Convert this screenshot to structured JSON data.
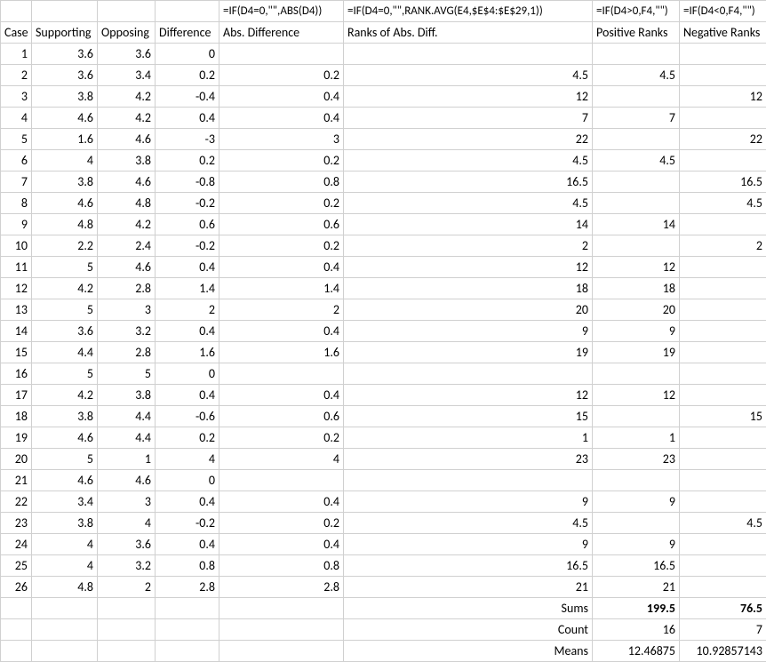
{
  "formulas": {
    "abs": "=IF(D4=0,\"\",ABS(D4))",
    "rank": "=IF(D4=0,\"\",RANK.AVG(E4,$E$4:$E$29,1))",
    "pos": "=IF(D4>0,F4,\"\")",
    "neg": "=IF(D4<0,F4,\"\")"
  },
  "headers": {
    "case": "Case",
    "sup": "Supporting",
    "opp": "Opposing",
    "diff": "Difference",
    "abs": "Abs. Difference",
    "rank": "Ranks of Abs. Diff.",
    "pos": "Positive Ranks",
    "neg": "Negative Ranks"
  },
  "rows": [
    {
      "case": "1",
      "sup": "3.6",
      "opp": "3.6",
      "diff": "0",
      "abs": "",
      "rank": "",
      "pos": "",
      "neg": ""
    },
    {
      "case": "2",
      "sup": "3.6",
      "opp": "3.4",
      "diff": "0.2",
      "abs": "0.2",
      "rank": "4.5",
      "pos": "4.5",
      "neg": ""
    },
    {
      "case": "3",
      "sup": "3.8",
      "opp": "4.2",
      "diff": "-0.4",
      "abs": "0.4",
      "rank": "12",
      "pos": "",
      "neg": "12"
    },
    {
      "case": "4",
      "sup": "4.6",
      "opp": "4.2",
      "diff": "0.4",
      "abs": "0.4",
      "rank": "7",
      "pos": "7",
      "neg": ""
    },
    {
      "case": "5",
      "sup": "1.6",
      "opp": "4.6",
      "diff": "-3",
      "abs": "3",
      "rank": "22",
      "pos": "",
      "neg": "22"
    },
    {
      "case": "6",
      "sup": "4",
      "opp": "3.8",
      "diff": "0.2",
      "abs": "0.2",
      "rank": "4.5",
      "pos": "4.5",
      "neg": ""
    },
    {
      "case": "7",
      "sup": "3.8",
      "opp": "4.6",
      "diff": "-0.8",
      "abs": "0.8",
      "rank": "16.5",
      "pos": "",
      "neg": "16.5"
    },
    {
      "case": "8",
      "sup": "4.6",
      "opp": "4.8",
      "diff": "-0.2",
      "abs": "0.2",
      "rank": "4.5",
      "pos": "",
      "neg": "4.5"
    },
    {
      "case": "9",
      "sup": "4.8",
      "opp": "4.2",
      "diff": "0.6",
      "abs": "0.6",
      "rank": "14",
      "pos": "14",
      "neg": ""
    },
    {
      "case": "10",
      "sup": "2.2",
      "opp": "2.4",
      "diff": "-0.2",
      "abs": "0.2",
      "rank": "2",
      "pos": "",
      "neg": "2"
    },
    {
      "case": "11",
      "sup": "5",
      "opp": "4.6",
      "diff": "0.4",
      "abs": "0.4",
      "rank": "12",
      "pos": "12",
      "neg": ""
    },
    {
      "case": "12",
      "sup": "4.2",
      "opp": "2.8",
      "diff": "1.4",
      "abs": "1.4",
      "rank": "18",
      "pos": "18",
      "neg": ""
    },
    {
      "case": "13",
      "sup": "5",
      "opp": "3",
      "diff": "2",
      "abs": "2",
      "rank": "20",
      "pos": "20",
      "neg": ""
    },
    {
      "case": "14",
      "sup": "3.6",
      "opp": "3.2",
      "diff": "0.4",
      "abs": "0.4",
      "rank": "9",
      "pos": "9",
      "neg": ""
    },
    {
      "case": "15",
      "sup": "4.4",
      "opp": "2.8",
      "diff": "1.6",
      "abs": "1.6",
      "rank": "19",
      "pos": "19",
      "neg": ""
    },
    {
      "case": "16",
      "sup": "5",
      "opp": "5",
      "diff": "0",
      "abs": "",
      "rank": "",
      "pos": "",
      "neg": ""
    },
    {
      "case": "17",
      "sup": "4.2",
      "opp": "3.8",
      "diff": "0.4",
      "abs": "0.4",
      "rank": "12",
      "pos": "12",
      "neg": ""
    },
    {
      "case": "18",
      "sup": "3.8",
      "opp": "4.4",
      "diff": "-0.6",
      "abs": "0.6",
      "rank": "15",
      "pos": "",
      "neg": "15"
    },
    {
      "case": "19",
      "sup": "4.6",
      "opp": "4.4",
      "diff": "0.2",
      "abs": "0.2",
      "rank": "1",
      "pos": "1",
      "neg": ""
    },
    {
      "case": "20",
      "sup": "5",
      "opp": "1",
      "diff": "4",
      "abs": "4",
      "rank": "23",
      "pos": "23",
      "neg": ""
    },
    {
      "case": "21",
      "sup": "4.6",
      "opp": "4.6",
      "diff": "0",
      "abs": "",
      "rank": "",
      "pos": "",
      "neg": ""
    },
    {
      "case": "22",
      "sup": "3.4",
      "opp": "3",
      "diff": "0.4",
      "abs": "0.4",
      "rank": "9",
      "pos": "9",
      "neg": ""
    },
    {
      "case": "23",
      "sup": "3.8",
      "opp": "4",
      "diff": "-0.2",
      "abs": "0.2",
      "rank": "4.5",
      "pos": "",
      "neg": "4.5"
    },
    {
      "case": "24",
      "sup": "4",
      "opp": "3.6",
      "diff": "0.4",
      "abs": "0.4",
      "rank": "9",
      "pos": "9",
      "neg": ""
    },
    {
      "case": "25",
      "sup": "4",
      "opp": "3.2",
      "diff": "0.8",
      "abs": "0.8",
      "rank": "16.5",
      "pos": "16.5",
      "neg": ""
    },
    {
      "case": "26",
      "sup": "4.8",
      "opp": "2",
      "diff": "2.8",
      "abs": "2.8",
      "rank": "21",
      "pos": "21",
      "neg": ""
    }
  ],
  "summary": {
    "sums_label": "Sums",
    "sums_pos": "199.5",
    "sums_neg": "76.5",
    "count_label": "Count",
    "count_pos": "16",
    "count_neg": "7",
    "means_label": "Means",
    "means_pos": "12.46875",
    "means_neg": "10.92857143"
  }
}
